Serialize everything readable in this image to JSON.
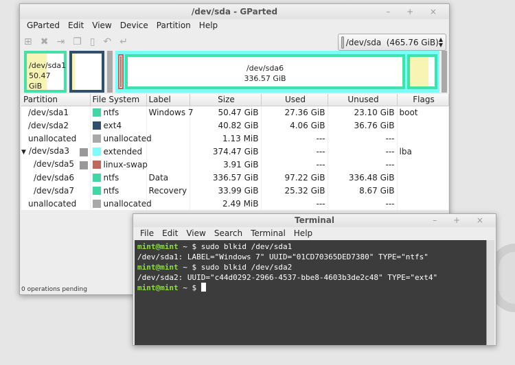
{
  "gparted": {
    "title": "/dev/sda - GParted",
    "menu": [
      "GParted",
      "Edit",
      "View",
      "Device",
      "Partition",
      "Help"
    ],
    "toolbar_icons": [
      "new-icon",
      "delete-icon",
      "resize-icon",
      "copy-icon",
      "paste-icon",
      "undo-icon",
      "apply-icon"
    ],
    "device": "/dev/sda  (465.76 GiB)",
    "bar": {
      "sda1_name": "/dev/sda1",
      "sda1_size": "50.47 GiB",
      "sda6_name": "/dev/sda6",
      "sda6_size": "336.57 GiB"
    },
    "columns": [
      "Partition",
      "File System",
      "Label",
      "Size",
      "Used",
      "Unused",
      "Flags"
    ],
    "rows": [
      {
        "partition": "/dev/sda1",
        "fs": "ntfs",
        "color": "#42d6a4",
        "label": "Windows 7",
        "size": "50.47 GiB",
        "used": "27.36 GiB",
        "unused": "23.10 GiB",
        "flags": "boot"
      },
      {
        "partition": "/dev/sda2",
        "fs": "ext4",
        "color": "#314e6c",
        "label": "",
        "size": "40.82 GiB",
        "used": "4.06 GiB",
        "unused": "36.76 GiB",
        "flags": ""
      },
      {
        "partition": "unallocated",
        "fs": "unallocated",
        "color": "#a9a9a9",
        "label": "",
        "size": "1.13 MiB",
        "used": "---",
        "unused": "---",
        "flags": ""
      },
      {
        "partition": "/dev/sda3",
        "fs": "extended",
        "color": "#7dfcfe",
        "label": "",
        "size": "374.47 GiB",
        "used": "---",
        "unused": "---",
        "flags": "lba"
      },
      {
        "partition": "/dev/sda5",
        "fs": "linux-swap",
        "color": "#c1665a",
        "label": "",
        "size": "3.91 GiB",
        "used": "---",
        "unused": "---",
        "flags": ""
      },
      {
        "partition": "/dev/sda6",
        "fs": "ntfs",
        "color": "#42d6a4",
        "label": "Data",
        "size": "336.57 GiB",
        "used": "97.22 GiB",
        "unused": "336.48 GiB",
        "flags": ""
      },
      {
        "partition": "/dev/sda7",
        "fs": "ntfs",
        "color": "#42d6a4",
        "label": "Recovery",
        "size": "33.99 GiB",
        "used": "25.32 GiB",
        "unused": "8.67 GiB",
        "flags": ""
      },
      {
        "partition": "unallocated",
        "fs": "unallocated",
        "color": "#a9a9a9",
        "label": "",
        "size": "2.49 MiB",
        "used": "---",
        "unused": "---",
        "flags": ""
      }
    ],
    "status": "0 operations pending"
  },
  "terminal": {
    "title": "Terminal",
    "menu": [
      "File",
      "Edit",
      "View",
      "Search",
      "Terminal",
      "Help"
    ],
    "prompt": "mint@mint",
    "prompt_sep": " ~ $ ",
    "lines": [
      {
        "prompt": true,
        "text": "sudo blkid /dev/sda1"
      },
      {
        "prompt": false,
        "text": "/dev/sda1: LABEL=\"Windows 7\" UUID=\"01CD70365DED7380\" TYPE=\"ntfs\""
      },
      {
        "prompt": true,
        "text": "sudo blkid /dev/sda2"
      },
      {
        "prompt": false,
        "text": "/dev/sda2: UUID=\"c44d0292-2966-4537-bbe8-4603b3de2c48\" TYPE=\"ext4\""
      },
      {
        "prompt": true,
        "text": ""
      }
    ]
  }
}
